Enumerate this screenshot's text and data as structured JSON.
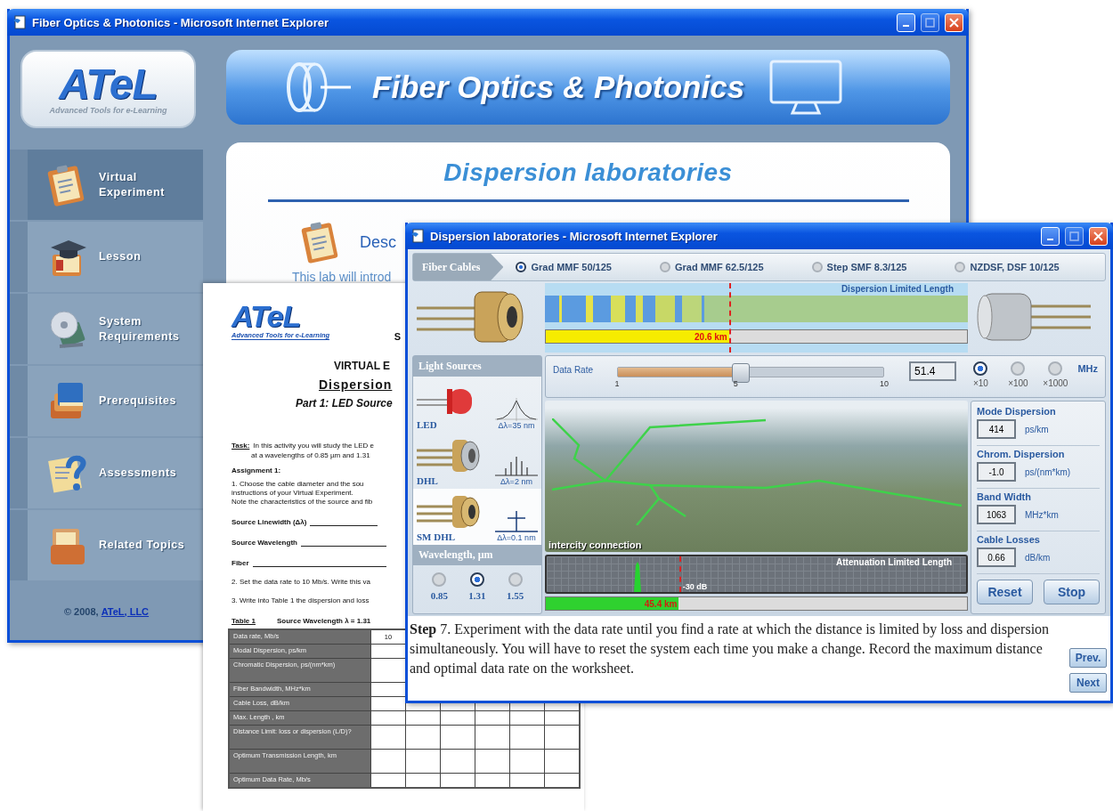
{
  "main_window": {
    "title": "Fiber Optics & Photonics - Microsoft Internet Explorer",
    "logo": {
      "text": "ATeL",
      "tagline": "Advanced Tools for e-Learning"
    },
    "banner_title": "Fiber Optics & Photonics",
    "sidebar": {
      "items": [
        {
          "label": "Virtual Experiment",
          "selected": true
        },
        {
          "label": "Lesson",
          "selected": false
        },
        {
          "label": "System Requirements",
          "selected": false
        },
        {
          "label": "Prerequisites",
          "selected": false
        },
        {
          "label": "Assessments",
          "selected": false
        },
        {
          "label": "Related Topics",
          "selected": false
        }
      ],
      "copyright": "© 2008, ",
      "copyright_link": "ATeL, LLC"
    },
    "content": {
      "heading": "Dispersion laboratories",
      "description_title": "Desc",
      "description": "This lab will introd"
    }
  },
  "worksheet": {
    "logo": "ATeL",
    "tagline": "Advanced Tools for e-Learning",
    "cut_letter": "S",
    "title": "VIRTUAL E",
    "subtitle": "Dispersion",
    "part": "Part 1: LED Source",
    "task_label": "Task:",
    "task": [
      "In this activity you will study the LED e",
      "at a wavelengths of  0.85 µm and 1.31"
    ],
    "assignment": "Assignment 1:",
    "instructions": [
      "1. Choose the cable diameter and the sou",
      "instructions of your Virtual Experiment.",
      "Note the characteristics of the source and fib"
    ],
    "fields": [
      {
        "label": "Source Linewidth (Δλ)"
      },
      {
        "label": "Source Wavelength"
      },
      {
        "label": "Fiber"
      }
    ],
    "steps": [
      "2. Set the data rate to 10 Mb/s.  Write this va",
      "3. Write into Table 1 the dispersion and loss"
    ],
    "table_caption": "Table 1",
    "table_wavelength": "Source Wavelength λ = 1.31",
    "table": {
      "rows": [
        {
          "label": "Data rate, Mb/s",
          "cells": [
            "10"
          ]
        },
        {
          "label": "Modal Dispersion, ps/km",
          "cells": []
        },
        {
          "label": "Chromatic Dispersion, ps/(nm*km)",
          "cells": []
        },
        {
          "label": "Fiber Bandwidth, MHz*km",
          "cells": []
        },
        {
          "label": "Cable Loss, dB/km",
          "cells": []
        },
        {
          "label": "Max. Length , km",
          "cells": []
        },
        {
          "label": "Distance Limit: loss or dispersion (L/D)?",
          "cells": []
        },
        {
          "label": "Optimum Transmission  Length, km",
          "cells": []
        },
        {
          "label": "Optimum Data Rate, Mb/s",
          "cells": []
        }
      ]
    }
  },
  "lab_window": {
    "title": "Dispersion laboratories - Microsoft Internet Explorer",
    "fiber_cables": {
      "label": "Fiber Cables",
      "options": [
        {
          "label": "Grad MMF 50/125",
          "selected": true
        },
        {
          "label": "Grad MMF 62.5/125",
          "selected": false
        },
        {
          "label": "Step SMF 8.3/125",
          "selected": false
        },
        {
          "label": "NZDSF, DSF 10/125",
          "selected": false
        }
      ]
    },
    "dispersion_chart": {
      "title": "Dispersion Limited Length",
      "distance": "20.6 km",
      "level": 0.435
    },
    "light_sources": {
      "title": "Light Sources",
      "items": [
        {
          "label": "LED",
          "linewidth": "Δλ=35 nm",
          "selected": false
        },
        {
          "label": "DHL",
          "linewidth": "Δλ=2 nm",
          "selected": false
        },
        {
          "label": "SM DHL",
          "linewidth": "Δλ=0.1 nm",
          "selected": true
        }
      ]
    },
    "wavelength": {
      "title": "Wavelength, µm",
      "options": [
        {
          "label": "0.85",
          "selected": false
        },
        {
          "label": "1.31",
          "selected": true
        },
        {
          "label": "1.55",
          "selected": false
        }
      ]
    },
    "data_rate": {
      "label": "Data Rate",
      "level": 0.46,
      "ticks": [
        "1",
        "5",
        "10"
      ],
      "value": "51.4",
      "unit": "MHz",
      "multipliers": [
        {
          "label": "×10",
          "selected": true
        },
        {
          "label": "×100",
          "selected": false
        },
        {
          "label": "×1000",
          "selected": false
        }
      ]
    },
    "photo": {
      "caption": "intercity connection"
    },
    "attenuation_chart": {
      "title": "Attenuation Limited Length",
      "threshold": "-30 dB",
      "distance": "45.4 km",
      "level": 0.316
    },
    "readings": [
      {
        "label": "Mode Dispersion",
        "value": "414",
        "unit": "ps/km"
      },
      {
        "label": "Chrom. Dispersion",
        "value": "-1.0",
        "unit": "ps/(nm*km)"
      },
      {
        "label": "Band Width",
        "value": "1063",
        "unit": "MHz*km"
      },
      {
        "label": "Cable Losses",
        "value": "0.66",
        "unit": "dB/km"
      }
    ],
    "buttons": [
      "Reset",
      "Stop"
    ],
    "step": "**Step** 7.  Experiment with the data rate until you find a rate at which the distance is limited by loss and dispersion simultaneously.  You will have to reset the system each time you make a change. Record the maximum distance and optimal data rate on the worksheet.",
    "nav": [
      "Prev.",
      "Next"
    ]
  }
}
